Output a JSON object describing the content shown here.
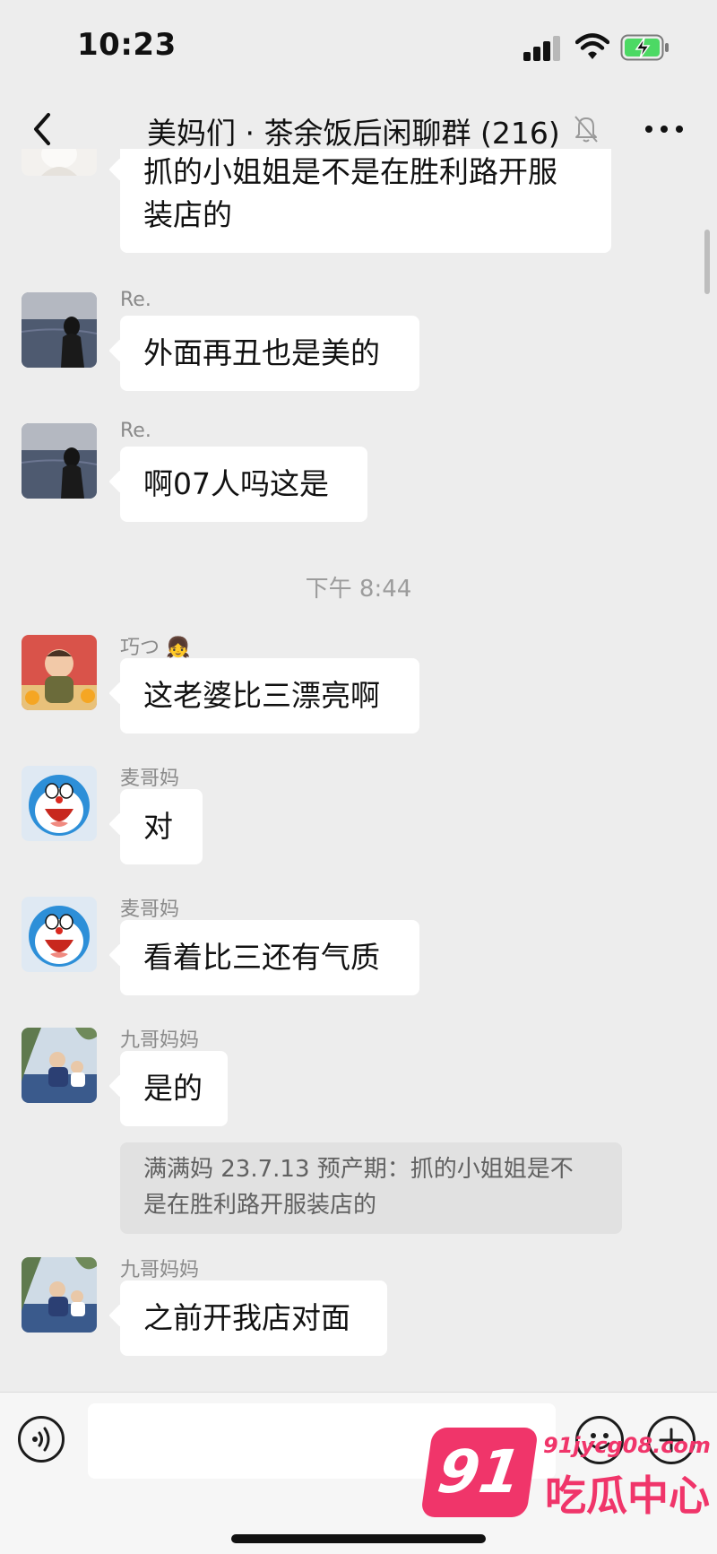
{
  "status_bar": {
    "time": "10:23",
    "icons": [
      "signal-icon",
      "wifi-icon",
      "battery-charging-icon"
    ]
  },
  "nav": {
    "back_icon": "back-chevron-icon",
    "title": "美妈们 · 茶余饭后闲聊群 (216)",
    "mute_icon": "bell-muted-icon",
    "more_icon": "more-dots-icon"
  },
  "chat": {
    "partial_message": {
      "lines": [
        "抓的小姐姐是不是在胜利路开服",
        "装店的"
      ]
    },
    "messages": [
      {
        "sender": "Re.",
        "text": "外面再丑也是美的",
        "avatar": "woman-by-sea-avatar"
      },
      {
        "sender": "Re.",
        "text": "啊07人吗这是",
        "avatar": "woman-by-sea-avatar"
      },
      {
        "sender": "巧つ",
        "sender_emoji": "👧",
        "text": "这老婆比三漂亮啊",
        "avatar": "baby-photo-avatar"
      },
      {
        "sender": "麦哥妈",
        "text": "对",
        "avatar": "doraemon-avatar"
      },
      {
        "sender": "麦哥妈",
        "text": "看着比三还有气质",
        "avatar": "doraemon-avatar"
      },
      {
        "sender": "九哥妈妈",
        "text": "是的",
        "avatar": "kid-outdoor-avatar"
      },
      {
        "sender": "九哥妈妈",
        "text": "之前开我店对面",
        "avatar": "kid-outdoor-avatar"
      }
    ],
    "time_divider": "下午 8:44",
    "quote": {
      "lines": [
        "满满妈 23.7.13 预产期：抓的小姐姐是不",
        "是在胜利路开服装店的"
      ]
    }
  },
  "input_bar": {
    "voice_icon": "voice-icon",
    "input_value": "",
    "emoji_icon": "emoji-icon",
    "plus_icon": "plus-icon"
  },
  "watermark": {
    "number": "91",
    "url": "91jycg08.com",
    "name": "吃瓜中心",
    "color": "#f0356a"
  },
  "colors": {
    "background": "#ededed",
    "bubble": "#ffffff",
    "quote_bg": "#e1e1e1",
    "meta_text": "#8a8a8a"
  }
}
